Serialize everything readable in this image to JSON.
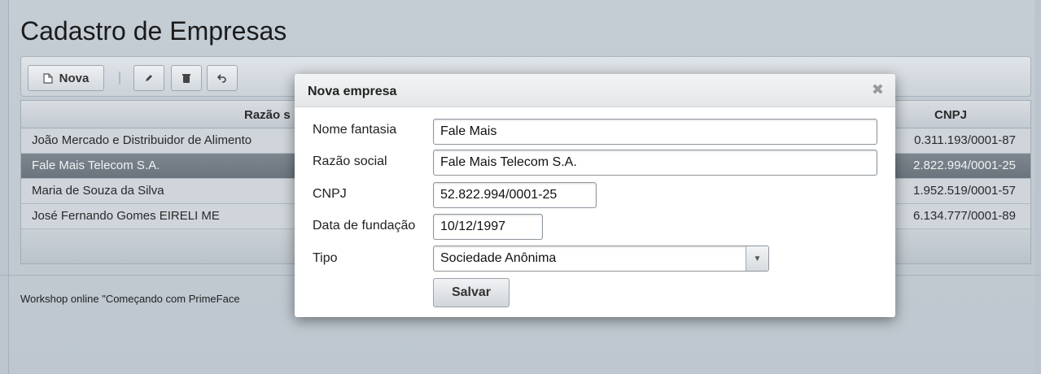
{
  "page": {
    "title": "Cadastro de Empresas",
    "footer": "Workshop online \"Começando com PrimeFace"
  },
  "toolbar": {
    "new_label": "Nova",
    "new_icon": "document-icon",
    "edit_icon": "pencil-icon",
    "delete_icon": "trash-icon",
    "undo_icon": "undo-icon"
  },
  "table": {
    "columns": [
      "Razão s",
      "CNPJ"
    ],
    "rows": [
      {
        "razao": "João Mercado e Distribuidor de Alimento",
        "cnpj": "0.311.193/0001-87",
        "selected": false
      },
      {
        "razao": "Fale Mais Telecom S.A.",
        "cnpj": "2.822.994/0001-25",
        "selected": true
      },
      {
        "razao": "Maria de Souza da Silva",
        "cnpj": "1.952.519/0001-57",
        "selected": false
      },
      {
        "razao": "José Fernando Gomes EIRELI ME",
        "cnpj": "6.134.777/0001-89",
        "selected": false
      }
    ]
  },
  "dialog": {
    "title": "Nova empresa",
    "close_icon": "close-icon",
    "fields": {
      "nome_fantasia": {
        "label": "Nome fantasia",
        "value": "Fale Mais"
      },
      "razao_social": {
        "label": "Razão social",
        "value": "Fale Mais Telecom S.A."
      },
      "cnpj": {
        "label": "CNPJ",
        "value": "52.822.994/0001-25"
      },
      "data_fundacao": {
        "label": "Data de fundação",
        "value": "10/12/1997"
      },
      "tipo": {
        "label": "Tipo",
        "value": "Sociedade Anônima"
      }
    },
    "save_label": "Salvar"
  }
}
